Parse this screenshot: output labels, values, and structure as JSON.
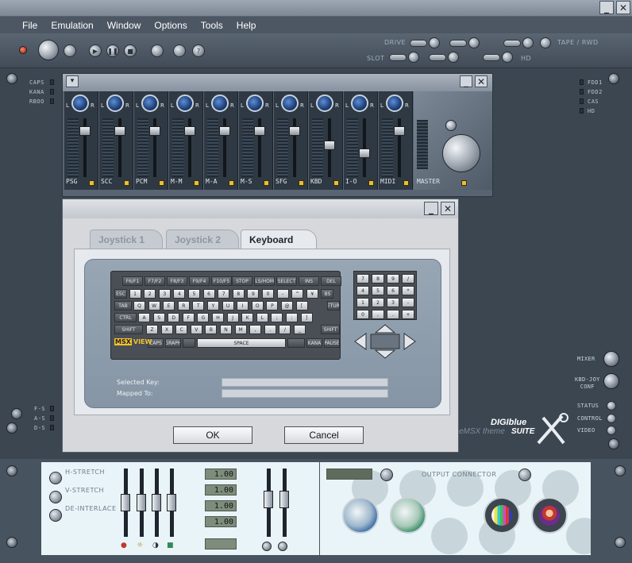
{
  "window": {
    "minimize_label": "_",
    "close_label": "✕"
  },
  "menu": [
    "File",
    "Emulation",
    "Window",
    "Options",
    "Tools",
    "Help"
  ],
  "topstrip": {
    "drive_label": "DRIVE",
    "slot_label": "SLOT",
    "tape_label": "TAPE / RWD",
    "hd_label": "HD"
  },
  "left_indicators": [
    "CAPS",
    "KANA",
    "RBOO"
  ],
  "left_indicators_bottom": [
    "F-S",
    "A-S",
    "D-S"
  ],
  "right_indicators": [
    "FDD1",
    "FDD2",
    "CAS",
    "HD"
  ],
  "mixer": {
    "channels": [
      "PSG",
      "SCC",
      "PCM",
      "M-M",
      "M-A",
      "M-S",
      "SFG",
      "KBD",
      "I-O",
      "MIDI"
    ],
    "master_label": "MASTER",
    "knob_l": "L",
    "knob_r": "R"
  },
  "dialog": {
    "tabs": [
      "Joystick 1",
      "Joystick 2",
      "Keyboard"
    ],
    "active_tab": "Keyboard",
    "selected_key_label": "Selected Key:",
    "mapped_to_label": "Mapped To:",
    "selected_key_value": "",
    "mapped_to_value": "",
    "ok_label": "OK",
    "cancel_label": "Cancel",
    "logo_msx": "MSX",
    "logo_view": "VIEW"
  },
  "keyboard": {
    "fkeys": [
      "F6/F1",
      "F7/F2",
      "F8/F3",
      "F9/F4",
      "F10/F5"
    ],
    "edit_keys": [
      "STOP",
      "CLS/HOME",
      "SELECT",
      "INS",
      "DEL"
    ],
    "row1": [
      "ESC",
      "1",
      "2",
      "3",
      "4",
      "5",
      "6",
      "7",
      "8",
      "9",
      "0",
      "-",
      "^",
      "¥",
      "BS"
    ],
    "row2": [
      "TAB",
      "Q",
      "W",
      "E",
      "R",
      "T",
      "Y",
      "U",
      "I",
      "O",
      "P",
      "@",
      "["
    ],
    "row3": [
      "CTRL",
      "A",
      "S",
      "D",
      "F",
      "G",
      "H",
      "J",
      "K",
      "L",
      ";",
      ":",
      "]"
    ],
    "row4": [
      "SHIFT",
      "Z",
      "X",
      "C",
      "V",
      "B",
      "N",
      "M",
      ",",
      ".",
      "/",
      "_",
      "SHIFT"
    ],
    "row5": [
      "CAPS",
      "GRAPH",
      "",
      "SPACE",
      "",
      "KANA",
      "PAUSE"
    ],
    "return_label": "RETURN",
    "numpad": [
      "7",
      "8",
      "9",
      "/",
      "4",
      "5",
      "6",
      "*",
      "1",
      "2",
      "3",
      "-",
      "0",
      ",",
      ".",
      "+"
    ]
  },
  "side_controls": {
    "mixer_label": "MIXER",
    "kbdjoy_label": "KBD-JOY\nCONF",
    "status_label": "STATUS",
    "control_label": "CONTROL",
    "video_label": "VIDEO"
  },
  "theme_brand": {
    "line1": "DIGIblue",
    "line2": "eMSX theme",
    "line3": "SUITE"
  },
  "video": {
    "h_stretch": "H-STRETCH",
    "v_stretch": "V-STRETCH",
    "de_interlace": "DE-INTERLACE",
    "values": [
      "1.00",
      "1.00",
      "1.00",
      "1.00"
    ]
  },
  "output": {
    "connector_label": "OUTPUT CONNECTOR"
  },
  "colors": {
    "accent_blue": "#1c3f7a",
    "led_yellow": "#e6c03a",
    "panel_bg": "#e9f4f8"
  }
}
